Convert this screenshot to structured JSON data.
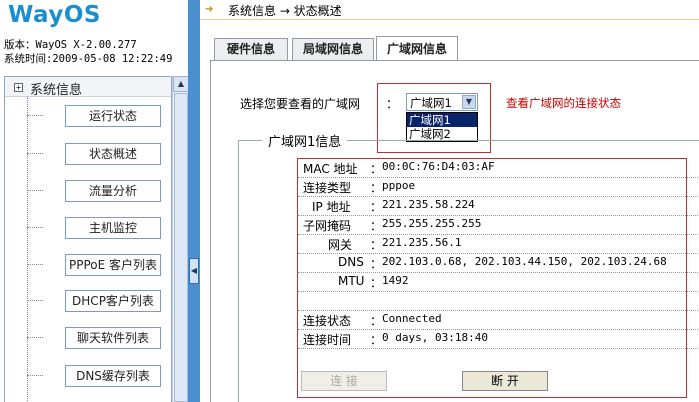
{
  "brand": {
    "logo": "WayOS",
    "color": "#1a8fd0"
  },
  "version": {
    "version_line": "版本：WayOS X-2.00.277",
    "time_line": "系统时间:2009-05-08 12:22:49"
  },
  "sidebar": {
    "group_label": "系统信息",
    "items": [
      {
        "label": "运行状态"
      },
      {
        "label": "状态概述"
      },
      {
        "label": "流量分析"
      },
      {
        "label": "主机监控"
      },
      {
        "label": "PPPoE 客户列表"
      },
      {
        "label": "DHCP客户列表"
      },
      {
        "label": "聊天软件列表"
      },
      {
        "label": "DNS缓存列表"
      }
    ]
  },
  "breadcrumb": {
    "text": "系统信息 → 状态概述"
  },
  "tabs": [
    {
      "label": "硬件信息"
    },
    {
      "label": "局域网信息"
    },
    {
      "label": "广域网信息"
    }
  ],
  "wan_select": {
    "label": "选择您要查看的广域网",
    "colon": "：",
    "selected": "广域网1",
    "options": [
      "广域网1",
      "广域网2"
    ],
    "hint": "查看广域网的连接状态",
    "hint_color": "#cc0000"
  },
  "info": {
    "legend": "广域网1信息",
    "colon": "：",
    "rows": [
      {
        "key": "MAC 地址",
        "value": "00:0C:76:D4:03:AF"
      },
      {
        "key": "连接类型",
        "value": "pppoe"
      },
      {
        "key": "IP 地址",
        "value": "221.235.58.224"
      },
      {
        "key": "子网掩码",
        "value": "255.255.255.255"
      },
      {
        "key": "网关",
        "value": "221.235.56.1"
      },
      {
        "key": "DNS",
        "value": "202.103.0.68, 202.103.44.150, 202.103.24.68"
      },
      {
        "key": "MTU",
        "value": "1492"
      },
      {
        "key": "连接状态",
        "value": "Connected"
      },
      {
        "key": "连接时间",
        "value": "0 days, 03:18:40"
      }
    ]
  },
  "actions": {
    "connect_label": "连 接",
    "disconnect_label": "断 开"
  },
  "colors": {
    "splitter": "#4a90d0",
    "highlight": "#c03030"
  }
}
